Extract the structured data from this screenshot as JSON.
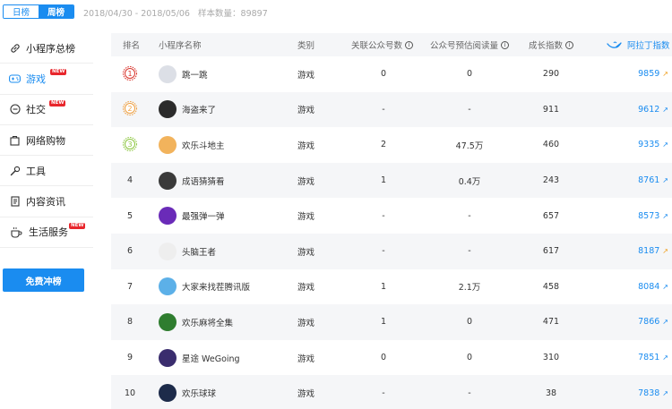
{
  "header": {
    "tab_daily": "日榜",
    "tab_weekly": "周榜",
    "date_range": "2018/04/30 - 2018/05/06",
    "sample_label": "样本数量：",
    "sample_count": "89897"
  },
  "sidebar": {
    "items": [
      {
        "label": "小程序总榜",
        "icon": "link-icon",
        "new": false
      },
      {
        "label": "游戏",
        "icon": "gamepad-icon",
        "new": true,
        "active": true
      },
      {
        "label": "社交",
        "icon": "chat-icon",
        "new": true
      },
      {
        "label": "网络购物",
        "icon": "shopping-bag-icon",
        "new": false
      },
      {
        "label": "工具",
        "icon": "wrench-icon",
        "new": false
      },
      {
        "label": "内容资讯",
        "icon": "document-icon",
        "new": false
      },
      {
        "label": "生活服务",
        "icon": "coffee-cup-icon",
        "new": true
      }
    ],
    "new_badge": "NEW",
    "cta_label": "免费冲榜"
  },
  "table": {
    "columns": {
      "rank": "排名",
      "name": "小程序名称",
      "category": "类别",
      "linked_accounts": "关联公众号数",
      "est_reads": "公众号预估阅读量",
      "growth": "成长指数",
      "aladdin": "阿拉丁指数"
    },
    "rows": [
      {
        "rank": "1",
        "name": "跳一跳",
        "category": "游戏",
        "linked": "0",
        "reads": "0",
        "growth": "290",
        "aladdin": "9859",
        "trend": "up-orange",
        "avatar_color": "#dcdfe6"
      },
      {
        "rank": "2",
        "name": "海盗来了",
        "category": "游戏",
        "linked": "-",
        "reads": "-",
        "growth": "911",
        "aladdin": "9612",
        "trend": "up-blue",
        "avatar_color": "#2b2b2b"
      },
      {
        "rank": "3",
        "name": "欢乐斗地主",
        "category": "游戏",
        "linked": "2",
        "reads": "47.5万",
        "growth": "460",
        "aladdin": "9335",
        "trend": "up-blue",
        "avatar_color": "#f2b35c"
      },
      {
        "rank": "4",
        "name": "成语猜猜看",
        "category": "游戏",
        "linked": "1",
        "reads": "0.4万",
        "growth": "243",
        "aladdin": "8761",
        "trend": "up-blue",
        "avatar_color": "#3a3a3a"
      },
      {
        "rank": "5",
        "name": "最强弹一弹",
        "category": "游戏",
        "linked": "-",
        "reads": "-",
        "growth": "657",
        "aladdin": "8573",
        "trend": "up-blue",
        "avatar_color": "#6a2bb8"
      },
      {
        "rank": "6",
        "name": "头脑王者",
        "category": "游戏",
        "linked": "-",
        "reads": "-",
        "growth": "617",
        "aladdin": "8187",
        "trend": "up-orange",
        "avatar_color": "#eeeeee"
      },
      {
        "rank": "7",
        "name": "大家来找茬腾讯版",
        "category": "游戏",
        "linked": "1",
        "reads": "2.1万",
        "growth": "458",
        "aladdin": "8084",
        "trend": "up-blue",
        "avatar_color": "#5cb0e8"
      },
      {
        "rank": "8",
        "name": "欢乐麻将全集",
        "category": "游戏",
        "linked": "1",
        "reads": "0",
        "growth": "471",
        "aladdin": "7866",
        "trend": "up-blue",
        "avatar_color": "#2f7d2f"
      },
      {
        "rank": "9",
        "name": "星途 WeGoing",
        "category": "游戏",
        "linked": "0",
        "reads": "0",
        "growth": "310",
        "aladdin": "7851",
        "trend": "up-blue",
        "avatar_color": "#3a2d6e"
      },
      {
        "rank": "10",
        "name": "欢乐球球",
        "category": "游戏",
        "linked": "-",
        "reads": "-",
        "growth": "38",
        "aladdin": "7838",
        "trend": "up-blue",
        "avatar_color": "#1d2b4a"
      }
    ]
  },
  "colors": {
    "accent": "#1a8cf0",
    "badge_red": "#e8262c",
    "rank1": "#d9362e",
    "rank2": "#f0a040",
    "rank3": "#8cc63f",
    "trend_orange": "#f0a020"
  }
}
